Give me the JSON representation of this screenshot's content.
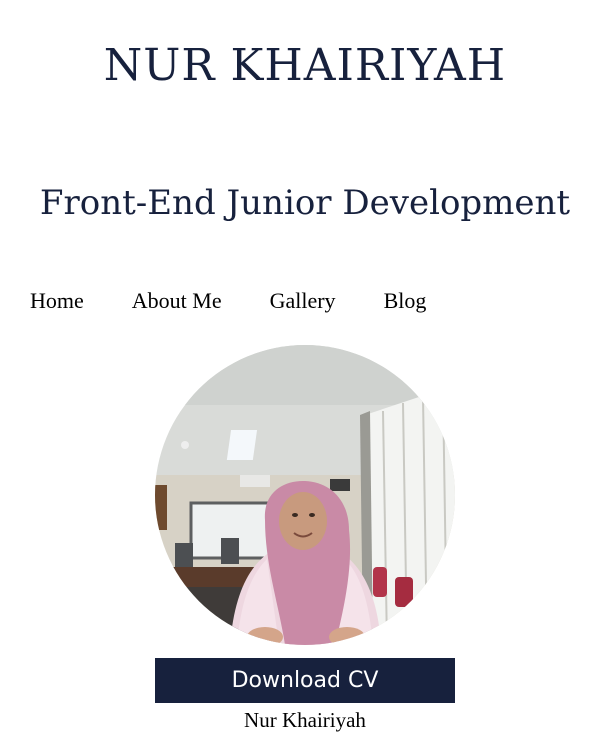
{
  "header": {
    "name": "NUR KHAIRIYAH",
    "role": "Front-End Junior Development"
  },
  "nav": {
    "items": [
      {
        "label": "Home"
      },
      {
        "label": "About Me"
      },
      {
        "label": "Gallery"
      },
      {
        "label": "Blog"
      }
    ]
  },
  "profile": {
    "photo_subject": "portrait photo of a woman in a pink hijab in a classroom",
    "download_label": "Download CV",
    "caption": "Nur Khairiyah"
  },
  "colors": {
    "primary": "#17213d",
    "background": "#ffffff",
    "hijab": "#c98aa6",
    "sweater": "#eed7e0"
  }
}
